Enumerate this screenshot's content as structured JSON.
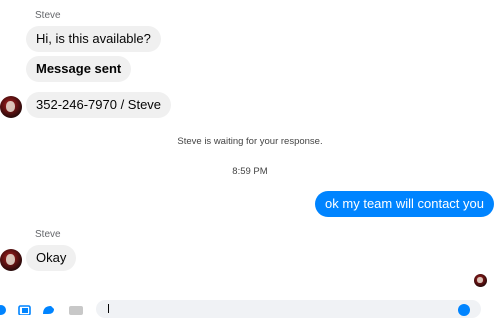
{
  "thread": {
    "group1": {
      "sender": "Steve",
      "messages": [
        {
          "text": "Hi, is this available?",
          "bold": false
        },
        {
          "text": "Message sent",
          "bold": true
        },
        {
          "text": "352-246-7970 / Steve",
          "bold": false
        }
      ]
    },
    "waiting_note": "Steve is waiting for your response.",
    "timestamp": "8:59 PM",
    "outgoing": {
      "text": "ok my team will contact you"
    },
    "group2": {
      "sender": "Steve",
      "messages": [
        {
          "text": "Okay"
        }
      ]
    }
  },
  "colors": {
    "outgoing_bubble": "#0084ff",
    "incoming_bubble": "#f0f0f0",
    "accent": "#0084ff"
  },
  "composer": {
    "icons": [
      "plus-icon",
      "photo-icon",
      "sticker-icon",
      "gif-icon",
      "emoji-icon"
    ]
  }
}
